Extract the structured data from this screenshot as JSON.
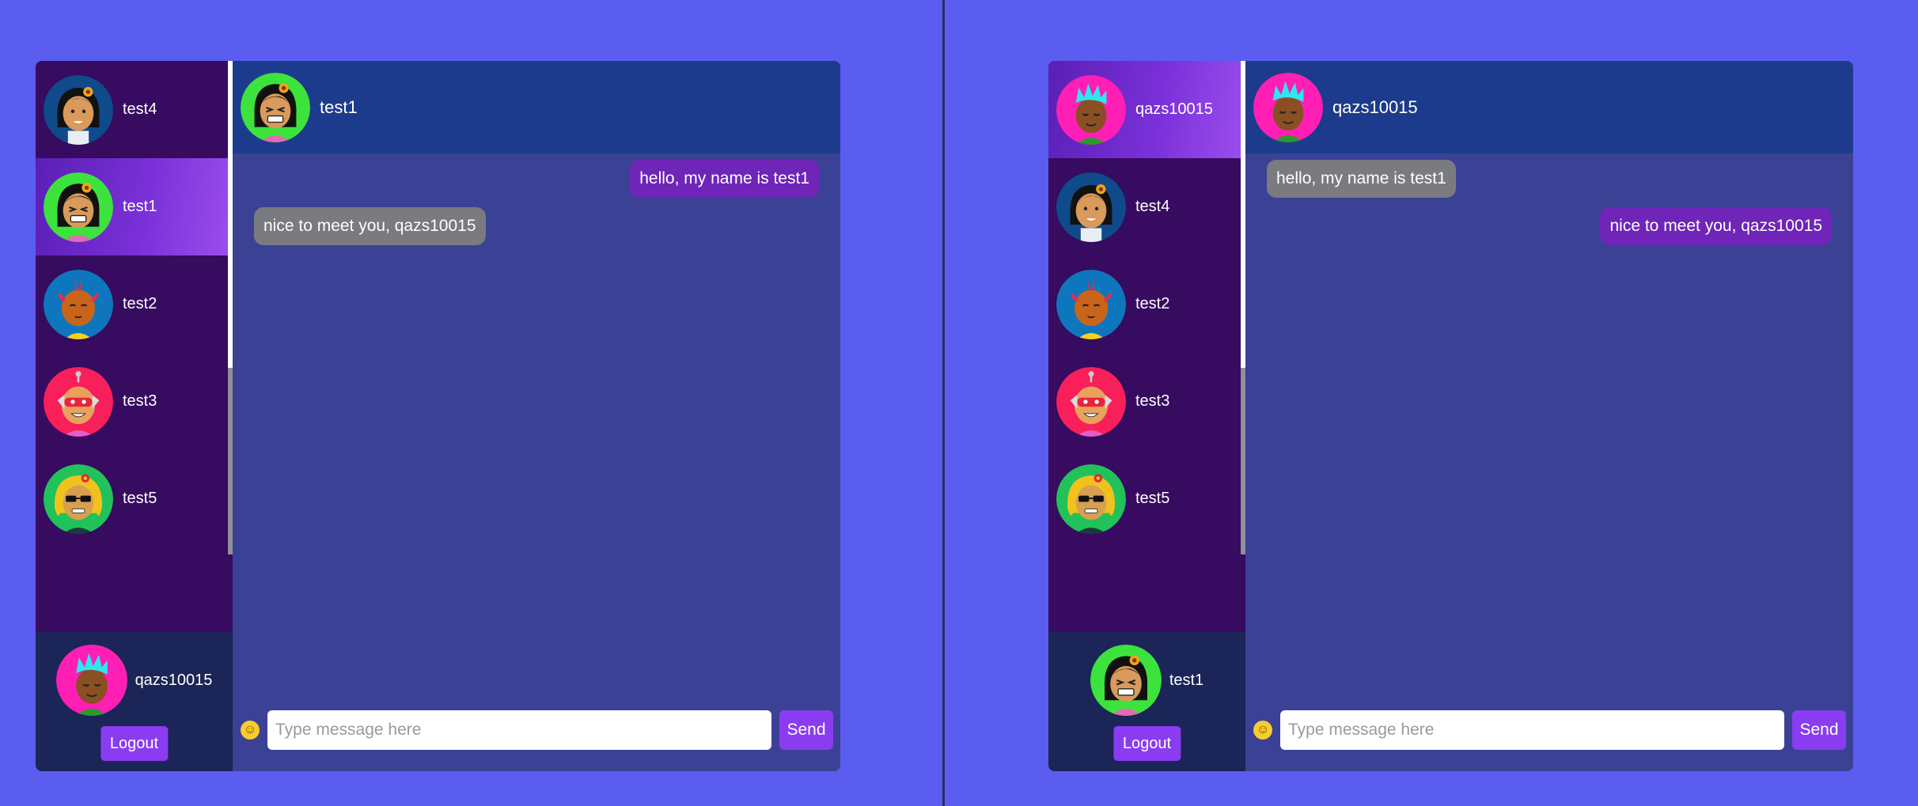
{
  "left": {
    "contacts": [
      {
        "name": "test4",
        "avatar": "girl-black-hair-flower-avatar",
        "bg": "#0f4a8a"
      },
      {
        "name": "test1",
        "avatar": "girl-grinning-flower-avatar",
        "bg": "#3de33d"
      },
      {
        "name": "test2",
        "avatar": "boy-mohawk-avatar",
        "bg": "#0e76bd"
      },
      {
        "name": "test3",
        "avatar": "robot-mask-avatar",
        "bg": "#f81f5a"
      },
      {
        "name": "test5",
        "avatar": "blonde-sunglasses-avatar",
        "bg": "#21c25a"
      }
    ],
    "selected": "test1",
    "current_user": {
      "name": "qazs10015",
      "avatar": "cyan-hair-smiling-avatar"
    },
    "logout_label": "Logout",
    "chat": {
      "title": "test1",
      "messages": [
        {
          "text": "hello, my name is test1",
          "direction": "sent"
        },
        {
          "text": "nice to meet you, qazs10015",
          "direction": "received"
        }
      ]
    },
    "placeholder": "Type message here",
    "send_label": "Send"
  },
  "right": {
    "contacts": [
      {
        "name": "qazs10015",
        "avatar": "cyan-hair-smiling-avatar",
        "bg": "#ff1fb4"
      },
      {
        "name": "test4",
        "avatar": "girl-black-hair-flower-avatar",
        "bg": "#0f4a8a"
      },
      {
        "name": "test2",
        "avatar": "boy-mohawk-avatar",
        "bg": "#0e76bd"
      },
      {
        "name": "test3",
        "avatar": "robot-mask-avatar",
        "bg": "#f81f5a"
      },
      {
        "name": "test5",
        "avatar": "blonde-sunglasses-avatar",
        "bg": "#21c25a"
      }
    ],
    "selected": "qazs10015",
    "current_user": {
      "name": "test1",
      "avatar": "girl-grinning-flower-avatar"
    },
    "logout_label": "Logout",
    "chat": {
      "title": "qazs10015",
      "messages": [
        {
          "text": "hello, my name is test1",
          "direction": "received"
        },
        {
          "text": "nice to meet you, qazs10015",
          "direction": "sent"
        }
      ]
    },
    "placeholder": "Type message here",
    "send_label": "Send"
  },
  "colors": {
    "page_bg": "#5b5cf0",
    "sidebar_bg": "#360b60",
    "header_bg": "#1d3b8c",
    "chat_bg": "#3b4195",
    "sent_bubble": "#6f25b8",
    "received_bubble": "#7a7b80",
    "accent_button": "#8a3cf0"
  }
}
